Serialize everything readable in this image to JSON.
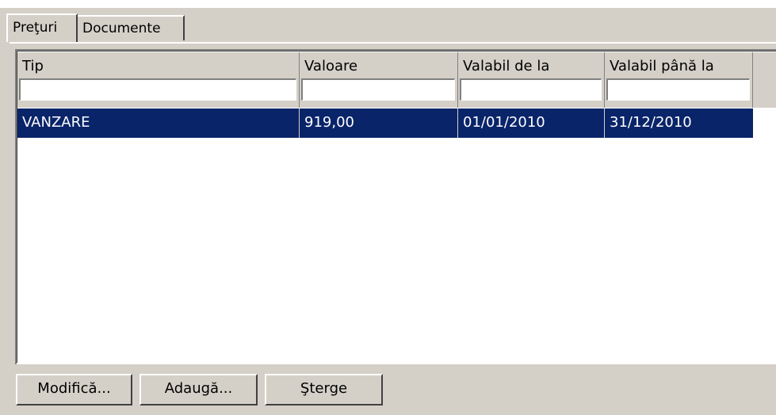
{
  "tabs": [
    {
      "label": "Preţuri",
      "active": true
    },
    {
      "label": "Documente",
      "active": false
    }
  ],
  "grid": {
    "columns": [
      "Tip",
      "Valoare",
      "Valabil de la",
      "Valabil până la"
    ],
    "filters": [
      "",
      "",
      "",
      ""
    ],
    "rows": [
      {
        "tip": "VANZARE",
        "valoare": "919,00",
        "valabil_de_la": "01/01/2010",
        "valabil_pana_la": "31/12/2010",
        "selected": true
      }
    ]
  },
  "buttons": {
    "modify": "Modifică...",
    "add": "Adaugă...",
    "delete": "Şterge"
  },
  "colors": {
    "selection": "#0a246a",
    "face": "#d4d0c8"
  }
}
